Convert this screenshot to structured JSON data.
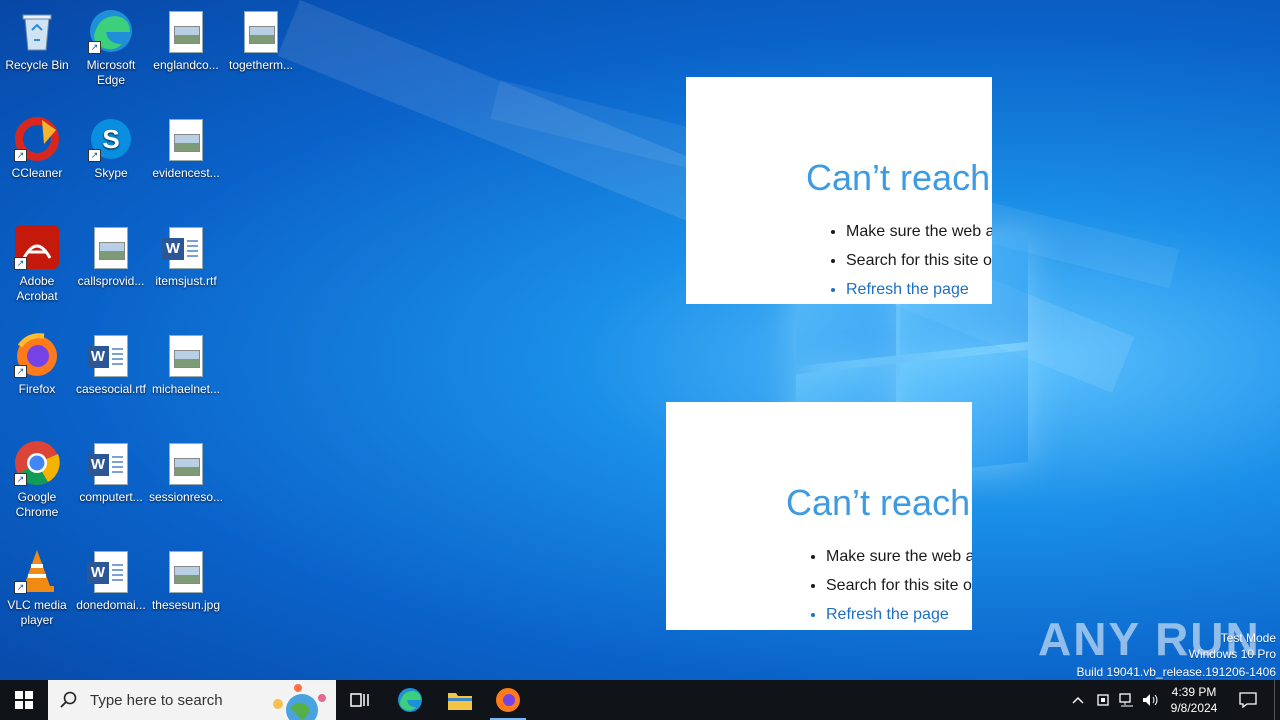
{
  "desktop": {
    "icons": [
      {
        "label": "Recycle Bin"
      },
      {
        "label": "Microsoft\nEdge"
      },
      {
        "label": "englandco..."
      },
      {
        "label": "togetherm..."
      },
      {
        "label": "CCleaner"
      },
      {
        "label": "Skype"
      },
      {
        "label": "evidencest..."
      },
      {
        "label": "Adobe\nAcrobat"
      },
      {
        "label": "callsprovid..."
      },
      {
        "label": "itemsjust.rtf"
      },
      {
        "label": "Firefox"
      },
      {
        "label": "casesocial.rtf"
      },
      {
        "label": "michaelnet..."
      },
      {
        "label": "Google\nChrome"
      },
      {
        "label": "computert..."
      },
      {
        "label": "sessionreso..."
      },
      {
        "label": "VLC media\nplayer"
      },
      {
        "label": "donedomai..."
      },
      {
        "label": "thesesun.jpg"
      }
    ]
  },
  "error_windows": [
    {
      "title": "Can’t reach t",
      "items": [
        "Make sure the web ad",
        "Search for this site on",
        "Refresh the page"
      ]
    },
    {
      "title": "Can’t reach t",
      "items": [
        "Make sure the web ad",
        "Search for this site on",
        "Refresh the page"
      ]
    }
  ],
  "watermark": {
    "brand": "ANY RUN",
    "line1": "Test Mode",
    "line2": "Windows 10 Pro",
    "line3": "Build 19041.vb_release.191206-1406"
  },
  "taskbar": {
    "search_placeholder": "Type here to search",
    "time": "4:39 PM",
    "date": "9/8/2024"
  }
}
